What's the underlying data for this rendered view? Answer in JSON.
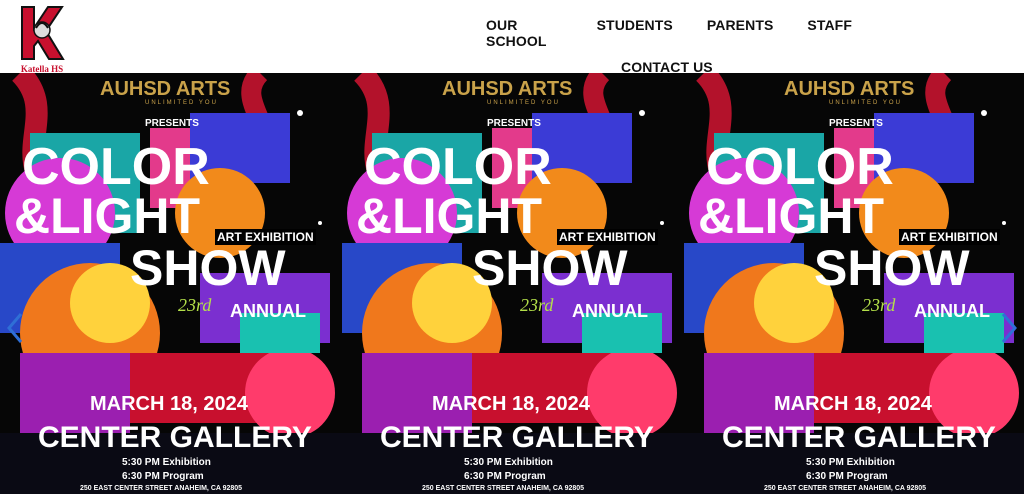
{
  "header": {
    "logo_letter": "K",
    "logo_text": "Katella HS",
    "nav": [
      "OUR SCHOOL",
      "STUDENTS",
      "PARENTS",
      "STAFF",
      "CONTACT US"
    ]
  },
  "poster": {
    "brand": "AUHSD ARTS",
    "tagline": "UNLIMITED YOU",
    "presents": "PRESENTS",
    "title1": "COLOR",
    "title2": "&LIGHT",
    "title3": "SHOW",
    "art_exhibition": "ART EXHIBITION",
    "edition": "23rd",
    "annual": "ANNUAL",
    "date": "MARCH 18, 2024",
    "venue": "CENTER GALLERY",
    "time1": "5:30 PM Exhibition",
    "time2": "6:30 PM Program",
    "address": "250 EAST CENTER STREET ANAHEIM, CA 92805"
  },
  "slider": {
    "prev_icon": "chevron-left-icon",
    "next_icon": "chevron-right-icon",
    "arrow_color": "#2f6fd6"
  },
  "colors": {
    "brand_red": "#c8102e",
    "gold": "#c9a24a"
  }
}
